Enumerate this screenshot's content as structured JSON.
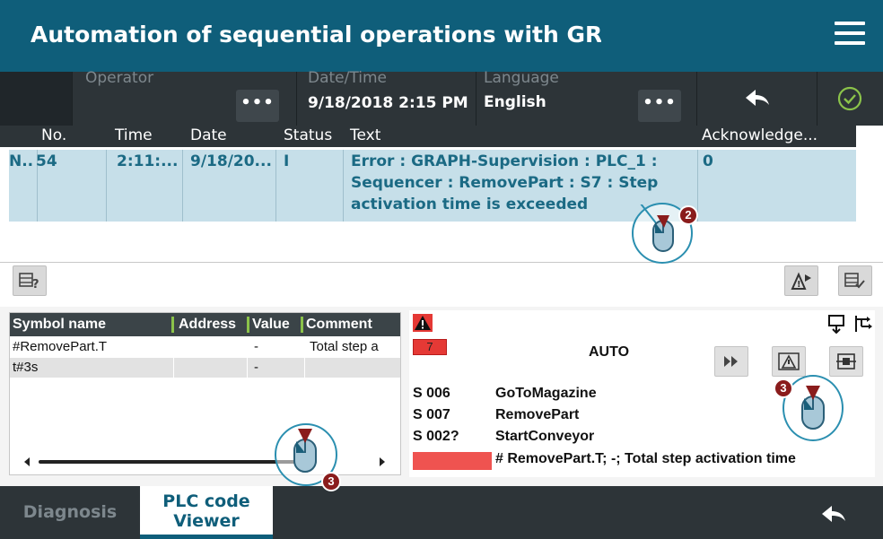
{
  "title": "Automation of sequential operations with GRAPH",
  "infobar": {
    "operator_label": "Operator",
    "datetime_label": "Date/Time",
    "datetime_value": "9/18/2018 2:15 PM",
    "language_label": "Language",
    "language_value": "English",
    "dots": "•••"
  },
  "alarm_table": {
    "columns": [
      "No.",
      "Time",
      "Date",
      "Status",
      "Text",
      "Acknowledge..."
    ],
    "row": {
      "marker": "N..",
      "no": "54",
      "time": "2:11:...",
      "date": "9/18/20...",
      "status": "I",
      "text_lines": [
        "Error : GRAPH-Supervision : PLC_1 :",
        "Sequencer : RemovePart : S7 : Step",
        "activation time is exceeded"
      ],
      "ack": "0"
    }
  },
  "symbol_table": {
    "columns": [
      "Symbol name",
      "Address",
      "Value",
      "Comment"
    ],
    "rows": [
      {
        "name": "#RemovePart.T",
        "address": "",
        "value": "-",
        "comment": "Total step a"
      },
      {
        "name": "t#3s",
        "address": "",
        "value": "-",
        "comment": ""
      }
    ]
  },
  "graph_viewer": {
    "alarm_count": "7",
    "mode": "AUTO",
    "steps": [
      {
        "id": "S 006",
        "name": "GoToMagazine"
      },
      {
        "id": "S 007",
        "name": "RemovePart"
      },
      {
        "id": "S 002?",
        "name": "StartConveyor"
      }
    ],
    "condition_text": "# RemovePart.T; -; Total step activation time"
  },
  "tabs": {
    "diagnosis": "Diagnosis",
    "plc_line1": "PLC code",
    "plc_line2": "Viewer"
  },
  "callouts": {
    "badge_2": "2",
    "badge_3a": "3",
    "badge_3b": "3"
  },
  "colors": {
    "brand": "#0f5e7a",
    "dark_bar": "#2d3438",
    "alarm_row": "#c6dfe9",
    "alarm_red": "#e53935",
    "condition_red": "#ef5350",
    "ok_green": "#8bc34a"
  }
}
